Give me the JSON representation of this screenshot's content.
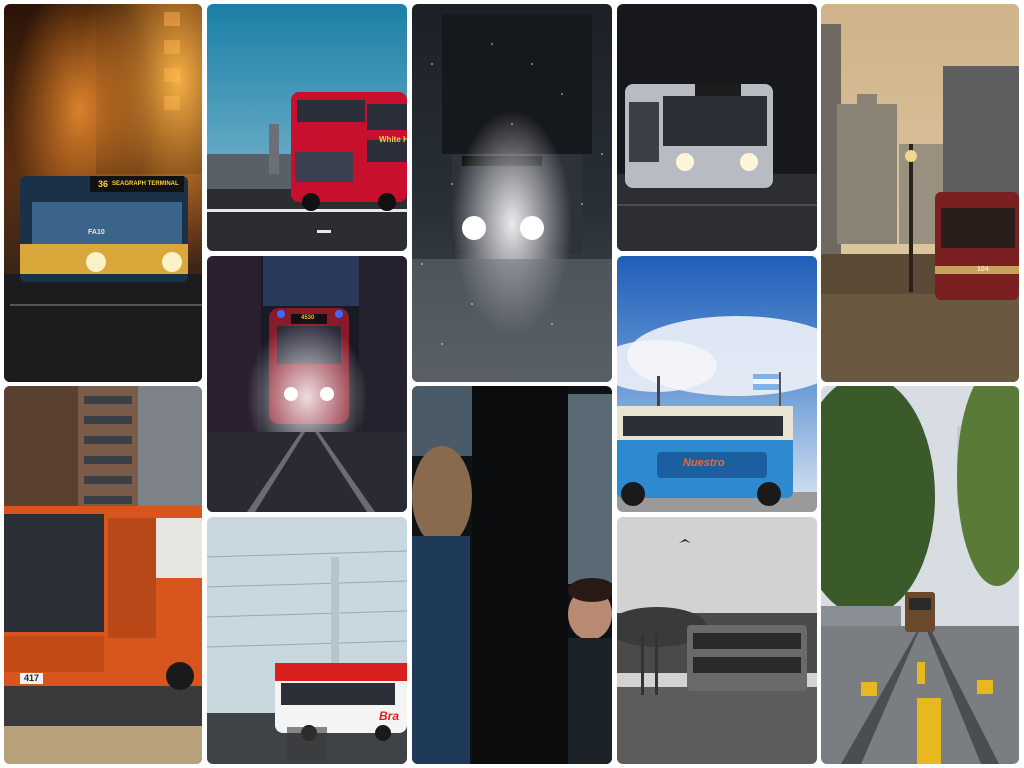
{
  "gallery": {
    "tiles": [
      {
        "id": "foggy-night-bus",
        "signs": {
          "route": "36",
          "destination": "SEAGRAPH TERMINAL",
          "plate": "FA10"
        }
      },
      {
        "id": "red-double-decker-westminster",
        "signs": {
          "destination": "White Ha..."
        }
      },
      {
        "id": "snowy-night-street-bus"
      },
      {
        "id": "night-bus-headlights-rain"
      },
      {
        "id": "chicago-trolley-rainy-street",
        "signs": {
          "number": "104"
        }
      },
      {
        "id": "red-tram-night-rain",
        "signs": {
          "route": "4530"
        }
      },
      {
        "id": "blue-vintage-bus-flag",
        "signs": {
          "livery": "Nuestro"
        }
      },
      {
        "id": "orange-city-bus-buildings",
        "signs": {
          "plate": "417"
        }
      },
      {
        "id": "red-white-bus-motion",
        "signs": {
          "livery": "Bra"
        }
      },
      {
        "id": "commuters-inside-bus"
      },
      {
        "id": "grayscale-double-decker-bird"
      },
      {
        "id": "san-francisco-cable-car-hill"
      }
    ]
  }
}
